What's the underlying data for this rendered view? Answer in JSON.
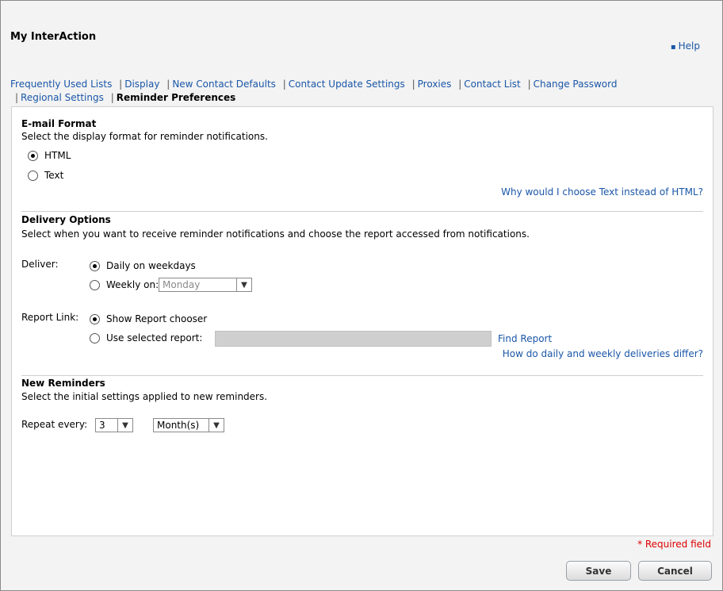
{
  "header": {
    "title": "My InterAction",
    "help_label": "Help",
    "help_bullet": "▪"
  },
  "tabs": [
    {
      "label": "Frequently Used Lists"
    },
    {
      "label": "Display"
    },
    {
      "label": "New Contact Defaults"
    },
    {
      "label": "Contact Update Settings"
    },
    {
      "label": "Proxies"
    },
    {
      "label": "Contact List"
    },
    {
      "label": "Change Password"
    },
    {
      "label": "Regional Settings"
    },
    {
      "label": "Reminder Preferences"
    }
  ],
  "tab_separator": "|",
  "email_format": {
    "title": "E-mail Format",
    "description": "Select the display format for reminder notifications.",
    "options": [
      {
        "label": "HTML",
        "checked": true
      },
      {
        "label": "Text",
        "checked": false
      }
    ],
    "help_link": "Why would I choose Text instead of HTML?"
  },
  "delivery": {
    "title": "Delivery Options",
    "description": "Select when you want to receive reminder notifications and choose the report accessed from notifications.",
    "deliver_label": "Deliver:",
    "deliver_options": [
      {
        "label": "Daily on weekdays",
        "checked": true
      },
      {
        "label": "Weekly on:",
        "checked": false
      }
    ],
    "weekday_select": "Monday",
    "report_link_label": "Report Link:",
    "report_options": [
      {
        "label": "Show Report chooser",
        "checked": true
      },
      {
        "label": "Use selected report:",
        "checked": false
      }
    ],
    "selected_report_value": "",
    "find_report": "Find Report",
    "help_link": "How do daily and weekly deliveries differ?"
  },
  "reminders": {
    "title": "New Reminders",
    "description": "Select the initial settings applied to new reminders.",
    "repeat_label": "Repeat every:",
    "repeat_value": "3",
    "repeat_unit": "Month(s)"
  },
  "footer": {
    "required_note": "* Required field",
    "save_label": "Save",
    "cancel_label": "Cancel"
  },
  "icons": {
    "dropdown_arrow": "chevron-down-icon"
  },
  "colors": {
    "link": "#1a56a8",
    "required": "#dd0000",
    "panel_bg": "#ffffff",
    "page_bg": "#f3f3f3"
  }
}
